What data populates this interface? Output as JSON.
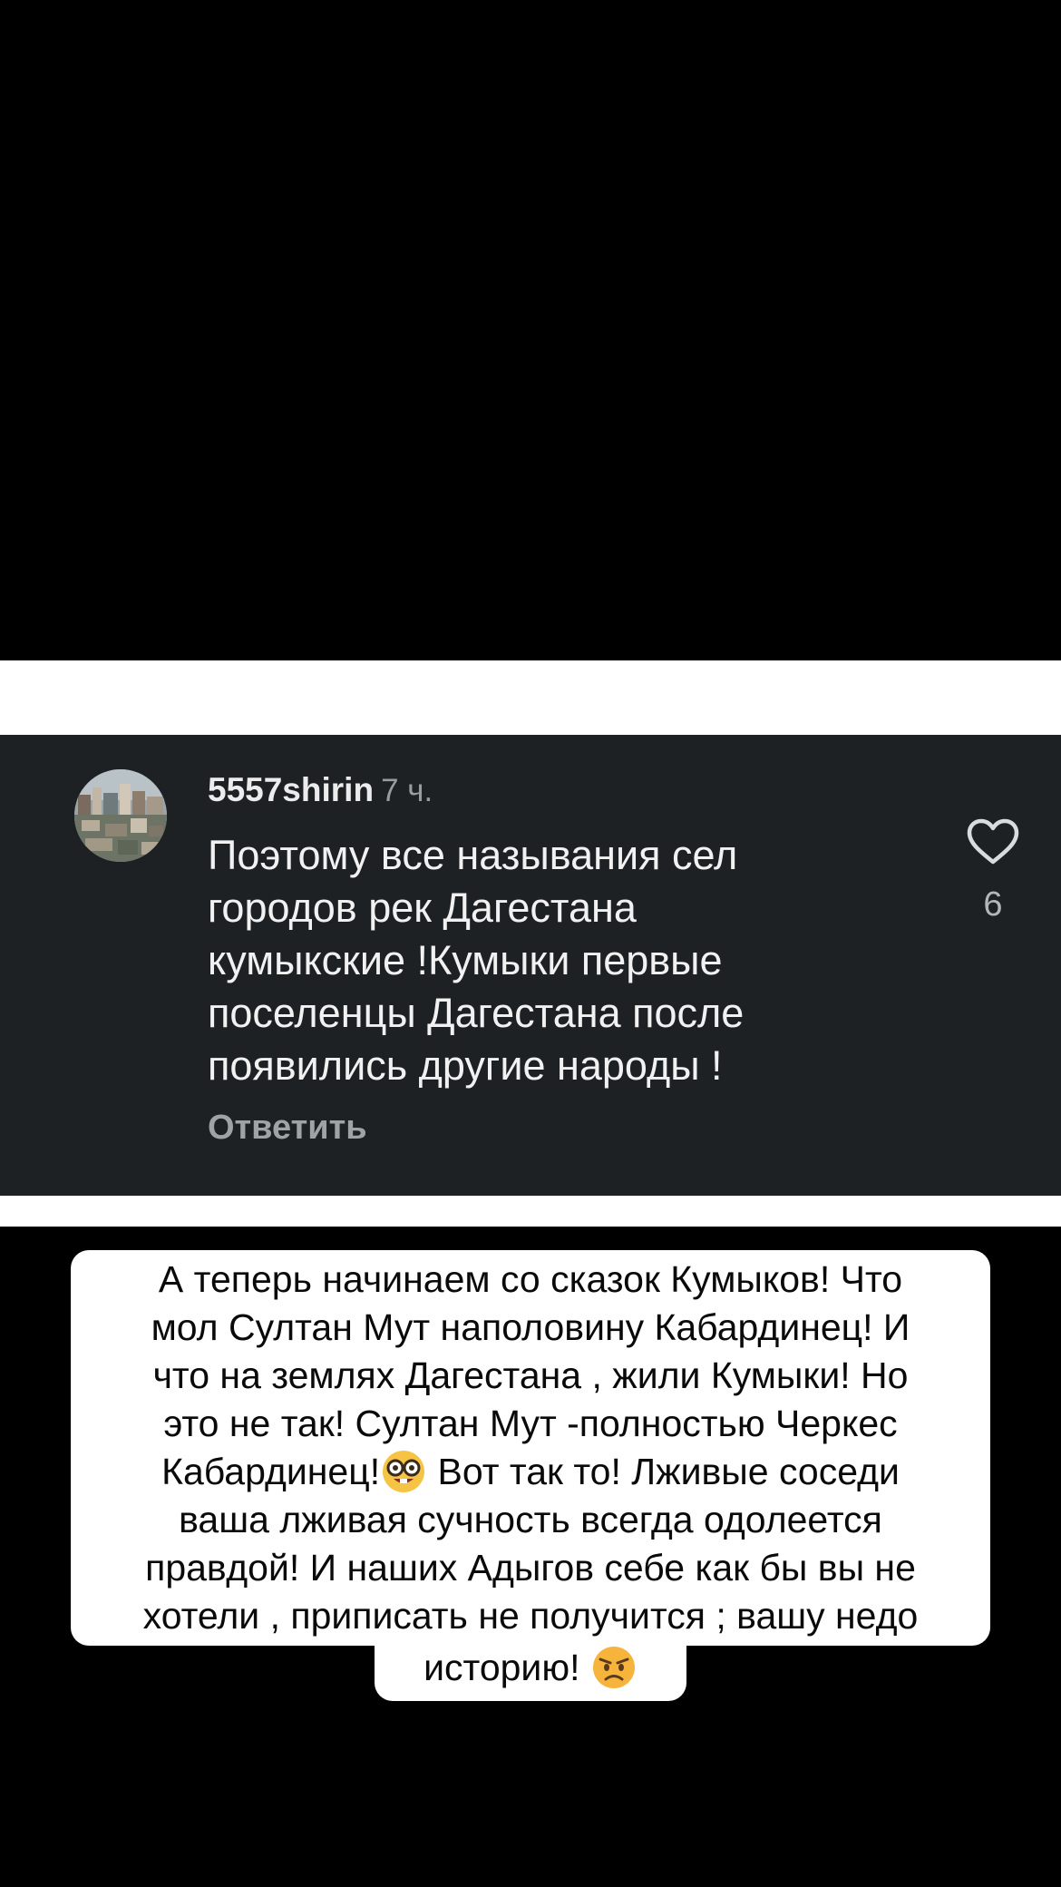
{
  "comment": {
    "username": "5557shirin",
    "timestamp": "7 ч.",
    "text": "Поэтому все называния сел\nгородов рек Дагестана\nкумыкские !Кумыки первые\nпоселенцы Дагестана  после\nпоявились другие народы !",
    "reply_label": "Ответить",
    "like_count": "6",
    "like_icon": "heart-outline-icon",
    "avatar_icon": "city-photo-avatar"
  },
  "caption": {
    "lines": [
      "А теперь начинаем  со сказок Кумыков! Что",
      "мол Султан Мут наполовину Кабардинец! И",
      "что на землях Дагестана , жили Кумыки! Но",
      "это не так! Султан Мут -полностью Черкес",
      "Кабардинец!",
      " Вот так то! Лживые соседи",
      "ваша лживая сучность всегда одолеется",
      "правдой! И наших Адыгов себе как бы вы не",
      "хотели , приписать не получится ; вашу недо",
      "историю! "
    ],
    "emoji_1": "nerd-face-emoji",
    "emoji_2": "angry-face-emoji"
  },
  "colors": {
    "background": "#000000",
    "card": "#1d2124",
    "band": "#ffffff",
    "caption_bg": "#ffffff"
  }
}
